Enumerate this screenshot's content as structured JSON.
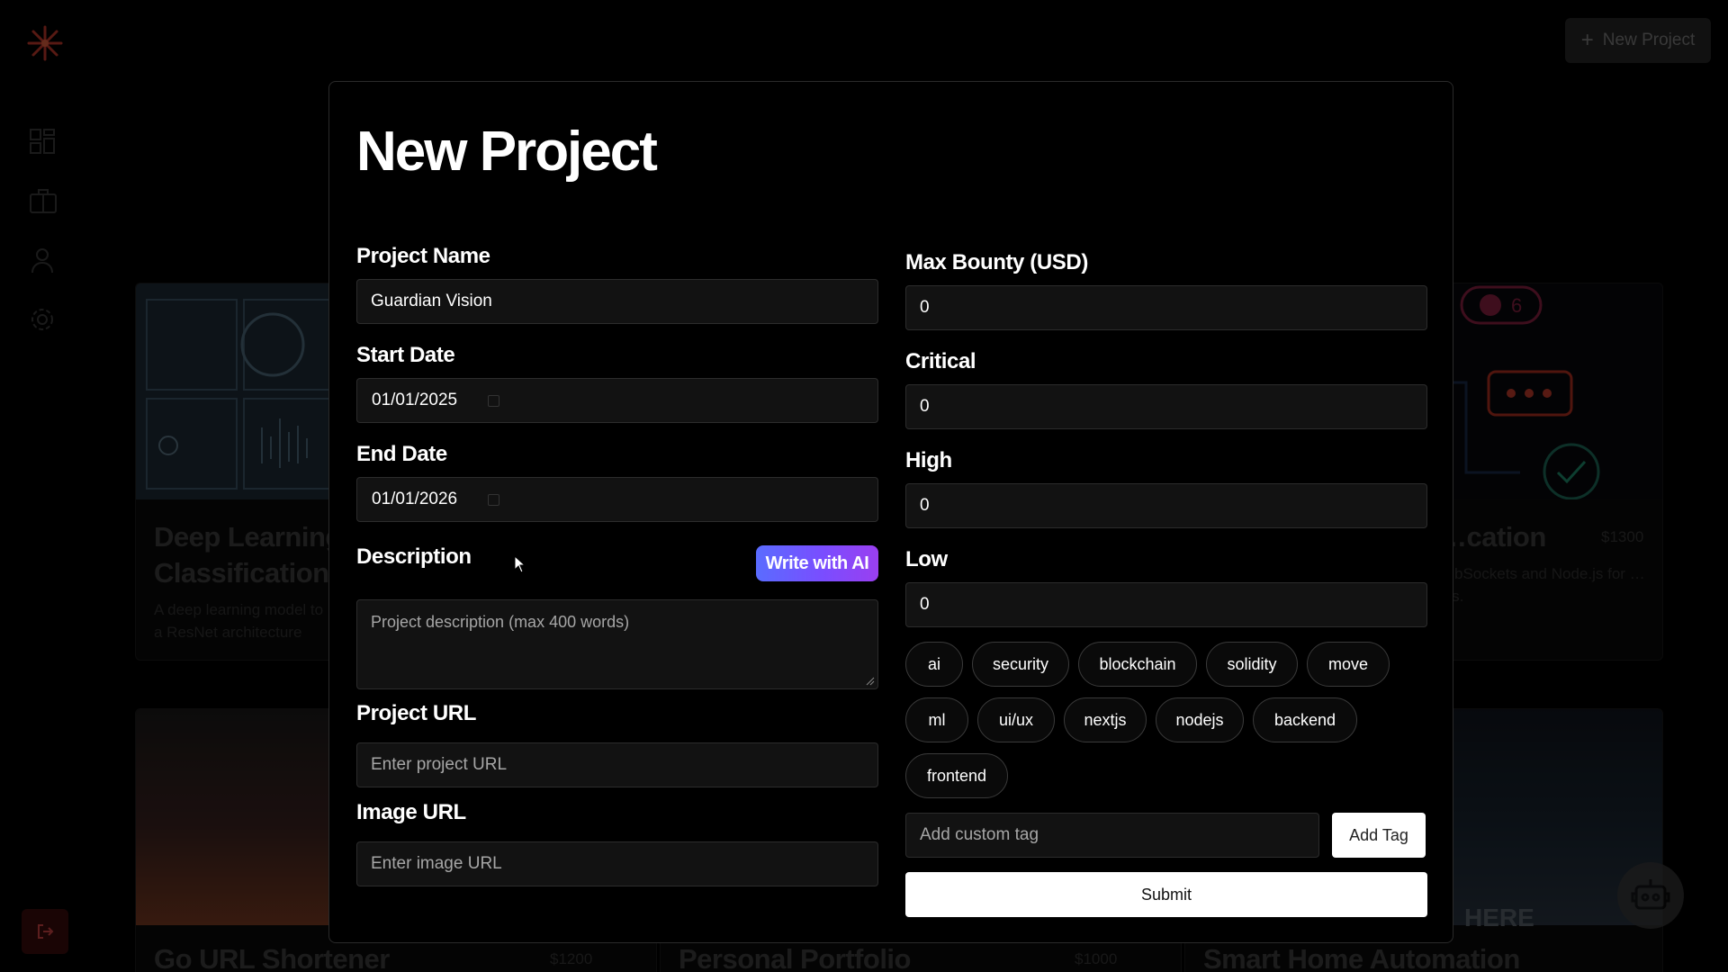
{
  "background": {
    "new_project_button": "New Project",
    "cards": [
      {
        "title": "Deep Learning Classification",
        "desc": "A deep learning model to … using a ResNet architecture"
      },
      {
        "title": "…cation",
        "price": "$1300",
        "desc": "…bSockets and Node.js for …nts."
      },
      {
        "title": "Go URL Shortener",
        "price": "$1200"
      },
      {
        "title": "Personal Portfolio",
        "price": "$1000"
      },
      {
        "title": "Smart Home Automation"
      }
    ],
    "overlay_text": "HERE",
    "badge_count": "6"
  },
  "modal": {
    "title": "New Project",
    "project_name": {
      "label": "Project Name",
      "value": "Guardian Vision"
    },
    "start_date": {
      "label": "Start Date",
      "value": "01/01/2025"
    },
    "end_date": {
      "label": "End Date",
      "value": "01/01/2026"
    },
    "description": {
      "label": "Description",
      "placeholder": "Project description (max 400 words)",
      "ai_button": "Write with AI"
    },
    "project_url": {
      "label": "Project URL",
      "placeholder": "Enter project URL"
    },
    "image_url": {
      "label": "Image URL",
      "placeholder": "Enter image URL"
    },
    "max_bounty": {
      "label": "Max Bounty (USD)",
      "value": "0"
    },
    "critical": {
      "label": "Critical",
      "value": "0"
    },
    "high": {
      "label": "High",
      "value": "0"
    },
    "low": {
      "label": "Low",
      "value": "0"
    },
    "tags": [
      "ai",
      "security",
      "blockchain",
      "solidity",
      "move",
      "ml",
      "ui/ux",
      "nextjs",
      "nodejs",
      "backend",
      "frontend"
    ],
    "custom_tag": {
      "placeholder": "Add custom tag",
      "button": "Add Tag"
    },
    "submit": "Submit"
  },
  "colors": {
    "accent_gradient_start": "#5a6cff",
    "accent_gradient_end": "#9a3ff0",
    "logout_bg": "#3a0c0c",
    "logo": "#c0392b"
  }
}
